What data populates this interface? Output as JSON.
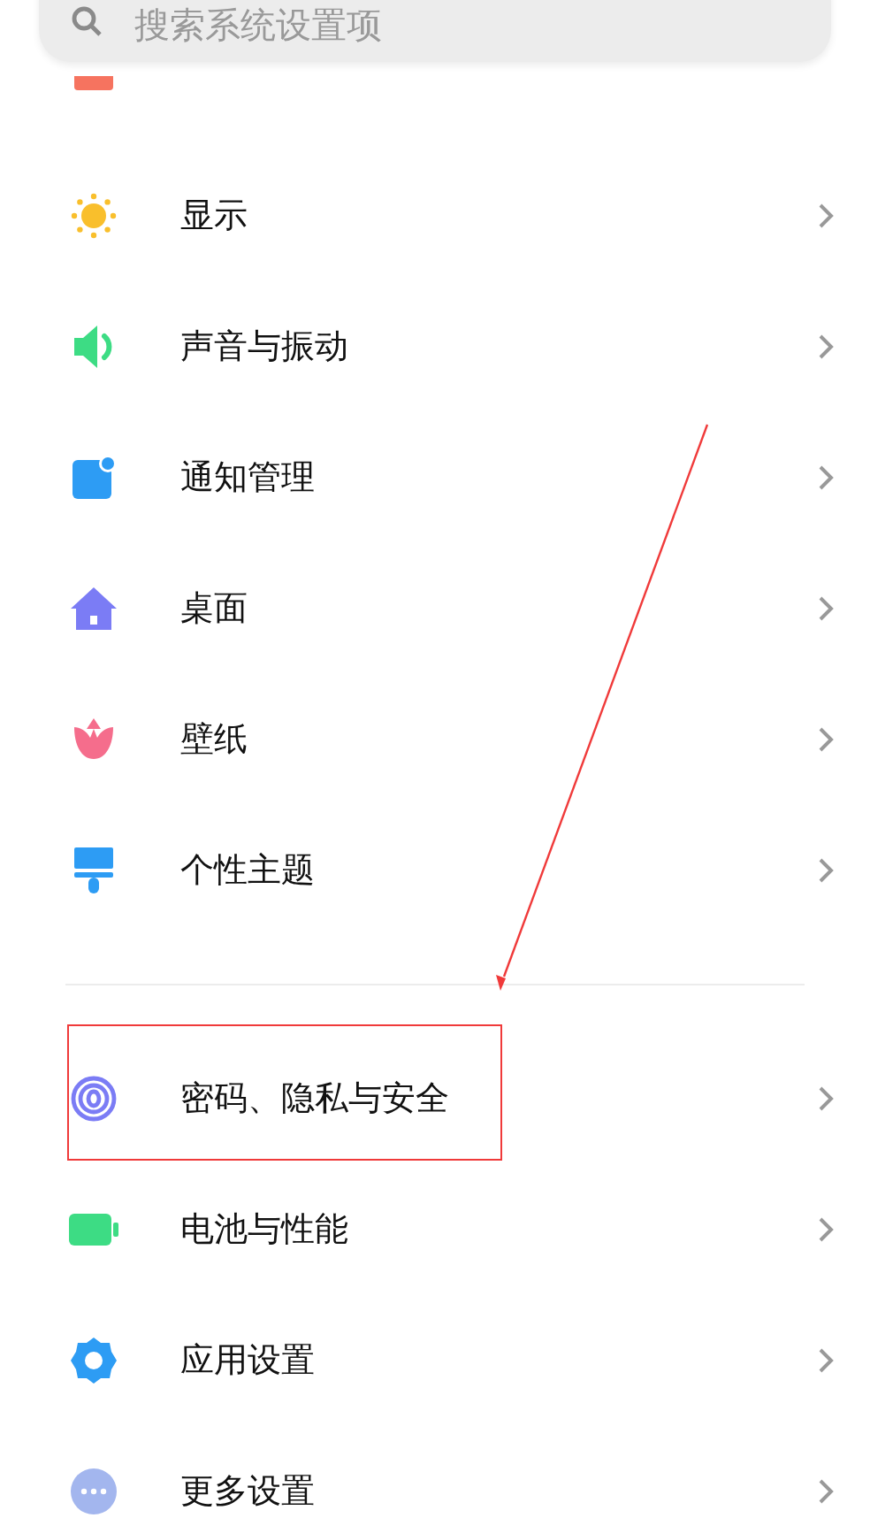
{
  "search": {
    "placeholder": "搜索系统设置项"
  },
  "sections": [
    {
      "items": [
        {
          "kind": "clipped"
        },
        {
          "kind": "row",
          "label": "显示",
          "highlighted": false
        },
        {
          "kind": "row",
          "label": "声音与振动",
          "highlighted": false
        },
        {
          "kind": "row",
          "label": "通知管理",
          "highlighted": false
        },
        {
          "kind": "row",
          "label": "桌面",
          "highlighted": false
        },
        {
          "kind": "row",
          "label": "壁纸",
          "highlighted": false
        },
        {
          "kind": "row",
          "label": "个性主题",
          "highlighted": false
        }
      ]
    },
    {
      "items": [
        {
          "kind": "row",
          "label": "密码、隐私与安全",
          "highlighted": true
        },
        {
          "kind": "row",
          "label": "电池与性能",
          "highlighted": false
        },
        {
          "kind": "row",
          "label": "应用设置",
          "highlighted": false
        },
        {
          "kind": "row",
          "label": "更多设置",
          "highlighted": false
        }
      ]
    }
  ],
  "annotations": [
    {
      "kind": "arrow"
    }
  ]
}
